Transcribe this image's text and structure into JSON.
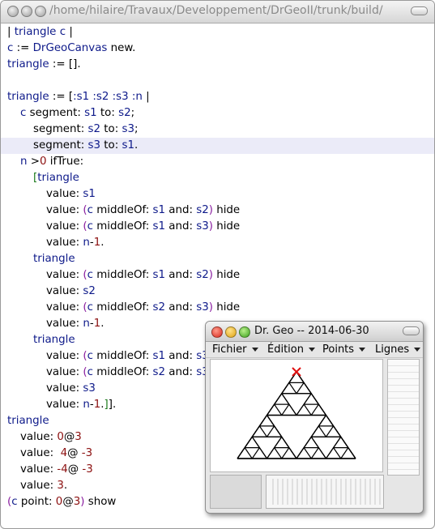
{
  "window": {
    "title": "/home/hilaire/Travaux/Developpement/DrGeoII/trunk/build/"
  },
  "code_lines": [
    {
      "indent": 8,
      "highlighted": false,
      "tokens": [
        {
          "t": "| ",
          "c": "msg"
        },
        {
          "t": "triangle",
          "c": "var"
        },
        {
          "t": " ",
          "c": "msg"
        },
        {
          "t": "c",
          "c": "var"
        },
        {
          "t": " |",
          "c": "msg"
        }
      ]
    },
    {
      "indent": 8,
      "highlighted": false,
      "tokens": [
        {
          "t": "c",
          "c": "var"
        },
        {
          "t": " := ",
          "c": "msg"
        },
        {
          "t": "DrGeoCanvas",
          "c": "var"
        },
        {
          "t": " new.",
          "c": "msg"
        }
      ]
    },
    {
      "indent": 8,
      "highlighted": false,
      "tokens": [
        {
          "t": "triangle",
          "c": "var"
        },
        {
          "t": " := [].",
          "c": "msg"
        }
      ]
    },
    {
      "indent": 8,
      "highlighted": false,
      "tokens": []
    },
    {
      "indent": 8,
      "highlighted": false,
      "tokens": [
        {
          "t": "triangle",
          "c": "var"
        },
        {
          "t": " := [",
          "c": "msg"
        },
        {
          "t": ":s1 :s2 :s3 :n",
          "c": "var"
        },
        {
          "t": " |",
          "c": "msg"
        }
      ]
    },
    {
      "indent": 24,
      "highlighted": false,
      "tokens": [
        {
          "t": "c",
          "c": "var"
        },
        {
          "t": " segment: ",
          "c": "msg"
        },
        {
          "t": "s1",
          "c": "var"
        },
        {
          "t": " to: ",
          "c": "msg"
        },
        {
          "t": "s2",
          "c": "var"
        },
        {
          "t": ";",
          "c": "msg"
        }
      ]
    },
    {
      "indent": 40,
      "highlighted": false,
      "tokens": [
        {
          "t": "segment: ",
          "c": "msg"
        },
        {
          "t": "s2",
          "c": "var"
        },
        {
          "t": " to: ",
          "c": "msg"
        },
        {
          "t": "s3",
          "c": "var"
        },
        {
          "t": ";",
          "c": "msg"
        }
      ]
    },
    {
      "indent": 40,
      "highlighted": true,
      "tokens": [
        {
          "t": "segment: ",
          "c": "msg"
        },
        {
          "t": "s3",
          "c": "var"
        },
        {
          "t": " to: ",
          "c": "msg"
        },
        {
          "t": "s1",
          "c": "var"
        },
        {
          "t": ".",
          "c": "msg"
        }
      ]
    },
    {
      "indent": 24,
      "highlighted": false,
      "tokens": [
        {
          "t": "n",
          "c": "var"
        },
        {
          "t": " >",
          "c": "msg"
        },
        {
          "t": "0",
          "c": "num"
        },
        {
          "t": " ifTrue:",
          "c": "msg"
        }
      ]
    },
    {
      "indent": 40,
      "highlighted": false,
      "tokens": [
        {
          "t": "[",
          "c": "brk"
        },
        {
          "t": "triangle",
          "c": "var"
        }
      ]
    },
    {
      "indent": 56,
      "highlighted": false,
      "tokens": [
        {
          "t": "value: ",
          "c": "msg"
        },
        {
          "t": "s1",
          "c": "var"
        }
      ]
    },
    {
      "indent": 56,
      "highlighted": false,
      "tokens": [
        {
          "t": "value: ",
          "c": "msg"
        },
        {
          "t": "(",
          "c": "par"
        },
        {
          "t": "c",
          "c": "var"
        },
        {
          "t": " middleOf: ",
          "c": "msg"
        },
        {
          "t": "s1",
          "c": "var"
        },
        {
          "t": " and: ",
          "c": "msg"
        },
        {
          "t": "s2",
          "c": "var"
        },
        {
          "t": ")",
          "c": "par"
        },
        {
          "t": " hide",
          "c": "msg"
        }
      ]
    },
    {
      "indent": 56,
      "highlighted": false,
      "tokens": [
        {
          "t": "value: ",
          "c": "msg"
        },
        {
          "t": "(",
          "c": "par"
        },
        {
          "t": "c",
          "c": "var"
        },
        {
          "t": " middleOf: ",
          "c": "msg"
        },
        {
          "t": "s1",
          "c": "var"
        },
        {
          "t": " and: ",
          "c": "msg"
        },
        {
          "t": "s3",
          "c": "var"
        },
        {
          "t": ")",
          "c": "par"
        },
        {
          "t": " hide",
          "c": "msg"
        }
      ]
    },
    {
      "indent": 56,
      "highlighted": false,
      "tokens": [
        {
          "t": "value: ",
          "c": "msg"
        },
        {
          "t": "n",
          "c": "var"
        },
        {
          "t": "-",
          "c": "msg"
        },
        {
          "t": "1",
          "c": "num"
        },
        {
          "t": ".",
          "c": "msg"
        }
      ]
    },
    {
      "indent": 40,
      "highlighted": false,
      "tokens": [
        {
          "t": "triangle",
          "c": "var"
        }
      ]
    },
    {
      "indent": 56,
      "highlighted": false,
      "tokens": [
        {
          "t": "value: ",
          "c": "msg"
        },
        {
          "t": "(",
          "c": "par"
        },
        {
          "t": "c",
          "c": "var"
        },
        {
          "t": " middleOf: ",
          "c": "msg"
        },
        {
          "t": "s1",
          "c": "var"
        },
        {
          "t": " and: ",
          "c": "msg"
        },
        {
          "t": "s2",
          "c": "var"
        },
        {
          "t": ")",
          "c": "par"
        },
        {
          "t": " hide",
          "c": "msg"
        }
      ]
    },
    {
      "indent": 56,
      "highlighted": false,
      "tokens": [
        {
          "t": "value: ",
          "c": "msg"
        },
        {
          "t": "s2",
          "c": "var"
        }
      ]
    },
    {
      "indent": 56,
      "highlighted": false,
      "tokens": [
        {
          "t": "value: ",
          "c": "msg"
        },
        {
          "t": "(",
          "c": "par"
        },
        {
          "t": "c",
          "c": "var"
        },
        {
          "t": " middleOf: ",
          "c": "msg"
        },
        {
          "t": "s2",
          "c": "var"
        },
        {
          "t": " and: ",
          "c": "msg"
        },
        {
          "t": "s3",
          "c": "var"
        },
        {
          "t": ")",
          "c": "par"
        },
        {
          "t": " hide",
          "c": "msg"
        }
      ]
    },
    {
      "indent": 56,
      "highlighted": false,
      "tokens": [
        {
          "t": "value: ",
          "c": "msg"
        },
        {
          "t": "n",
          "c": "var"
        },
        {
          "t": "-",
          "c": "msg"
        },
        {
          "t": "1",
          "c": "num"
        },
        {
          "t": ".",
          "c": "msg"
        }
      ]
    },
    {
      "indent": 40,
      "highlighted": false,
      "tokens": [
        {
          "t": "triangle",
          "c": "var"
        }
      ]
    },
    {
      "indent": 56,
      "highlighted": false,
      "tokens": [
        {
          "t": "value: ",
          "c": "msg"
        },
        {
          "t": "(",
          "c": "par"
        },
        {
          "t": "c",
          "c": "var"
        },
        {
          "t": " middleOf: ",
          "c": "msg"
        },
        {
          "t": "s1",
          "c": "var"
        },
        {
          "t": " and: ",
          "c": "msg"
        },
        {
          "t": "s3",
          "c": "var"
        }
      ]
    },
    {
      "indent": 56,
      "highlighted": false,
      "tokens": [
        {
          "t": "value: ",
          "c": "msg"
        },
        {
          "t": "(",
          "c": "par"
        },
        {
          "t": "c",
          "c": "var"
        },
        {
          "t": " middleOf: ",
          "c": "msg"
        },
        {
          "t": "s2",
          "c": "var"
        },
        {
          "t": " and: ",
          "c": "msg"
        },
        {
          "t": "s3",
          "c": "var"
        }
      ]
    },
    {
      "indent": 56,
      "highlighted": false,
      "tokens": [
        {
          "t": "value: ",
          "c": "msg"
        },
        {
          "t": "s3",
          "c": "var"
        }
      ]
    },
    {
      "indent": 56,
      "highlighted": false,
      "tokens": [
        {
          "t": "value: ",
          "c": "msg"
        },
        {
          "t": "n",
          "c": "var"
        },
        {
          "t": "-",
          "c": "msg"
        },
        {
          "t": "1",
          "c": "num"
        },
        {
          "t": ".",
          "c": "msg"
        },
        {
          "t": "]",
          "c": "brk"
        },
        {
          "t": "].",
          "c": "msg"
        }
      ]
    },
    {
      "indent": 8,
      "highlighted": false,
      "tokens": [
        {
          "t": "triangle",
          "c": "var"
        }
      ]
    },
    {
      "indent": 24,
      "highlighted": false,
      "tokens": [
        {
          "t": "value: ",
          "c": "msg"
        },
        {
          "t": "0",
          "c": "num"
        },
        {
          "t": "@",
          "c": "msg"
        },
        {
          "t": "3",
          "c": "num"
        }
      ]
    },
    {
      "indent": 24,
      "highlighted": false,
      "tokens": [
        {
          "t": "value:  ",
          "c": "msg"
        },
        {
          "t": "4",
          "c": "num"
        },
        {
          "t": "@ ",
          "c": "msg"
        },
        {
          "t": "-3",
          "c": "num"
        }
      ]
    },
    {
      "indent": 24,
      "highlighted": false,
      "tokens": [
        {
          "t": "value: ",
          "c": "msg"
        },
        {
          "t": "-4",
          "c": "num"
        },
        {
          "t": "@ ",
          "c": "msg"
        },
        {
          "t": "-3",
          "c": "num"
        }
      ]
    },
    {
      "indent": 24,
      "highlighted": false,
      "tokens": [
        {
          "t": "value: ",
          "c": "msg"
        },
        {
          "t": "3",
          "c": "num"
        },
        {
          "t": ".",
          "c": "msg"
        }
      ]
    },
    {
      "indent": 8,
      "highlighted": false,
      "tokens": [
        {
          "t": "(",
          "c": "par"
        },
        {
          "t": "c",
          "c": "var"
        },
        {
          "t": " point: ",
          "c": "msg"
        },
        {
          "t": "0",
          "c": "num"
        },
        {
          "t": "@",
          "c": "msg"
        },
        {
          "t": "3",
          "c": "num"
        },
        {
          "t": ")",
          "c": "par"
        },
        {
          "t": " show",
          "c": "msg"
        }
      ]
    }
  ],
  "drgeo": {
    "title": "Dr. Geo --  2014-06-30",
    "menus": [
      "Fichier",
      "Édition",
      "Points",
      "Lignes"
    ],
    "sierpinski_depth": 3
  },
  "colors": {
    "variable": "#0e1a8a",
    "number": "#8c1010",
    "paren": "#8a1ea0",
    "bracket": "#1a7a1a",
    "highlight": "#ebebf8",
    "point_marker": "#e01010"
  }
}
